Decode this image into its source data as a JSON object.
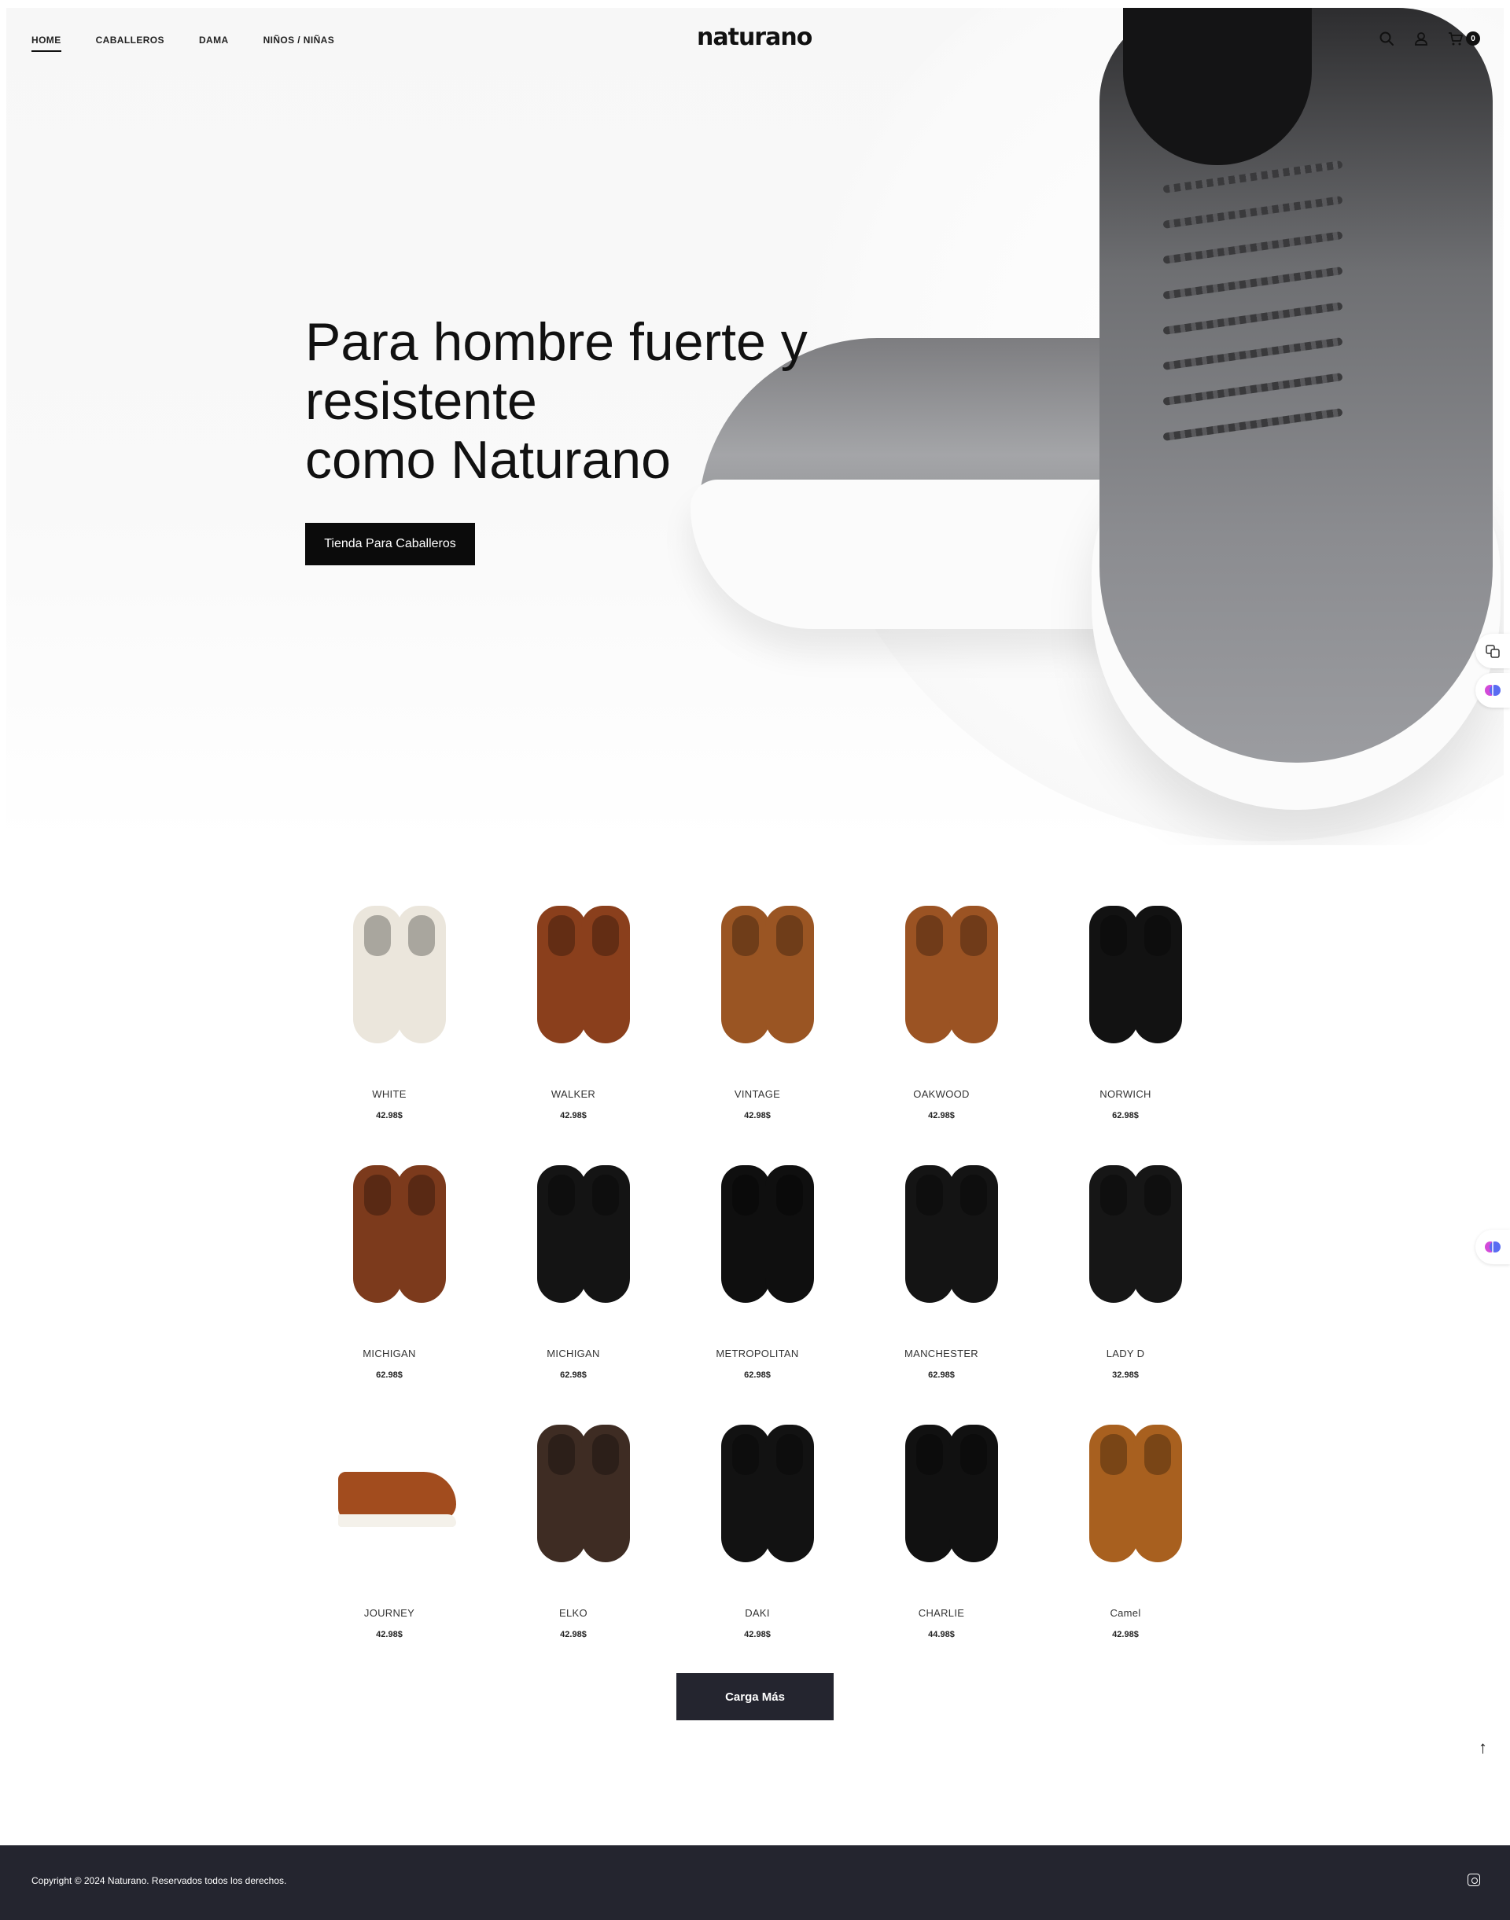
{
  "header": {
    "logo": "naturano",
    "nav": [
      {
        "label": "HOME",
        "active": true
      },
      {
        "label": "CABALLEROS",
        "active": false
      },
      {
        "label": "DAMA",
        "active": false
      },
      {
        "label": "NIÑOS / NIÑAS",
        "active": false
      }
    ],
    "icons": [
      "search-icon",
      "user-icon",
      "cart-icon"
    ],
    "cart_count": "0"
  },
  "hero": {
    "title_lines": [
      "Para hombre fuerte y",
      "resistente",
      "como Naturano"
    ],
    "button_label": "Tienda Para Caballeros"
  },
  "products": [
    {
      "name": "WHITE",
      "price": "42.98$",
      "color": "#ebe6dc"
    },
    {
      "name": "WALKER",
      "price": "42.98$",
      "color": "#8a3f1c"
    },
    {
      "name": "VINTAGE",
      "price": "42.98$",
      "color": "#9a5523"
    },
    {
      "name": "OAKWOOD",
      "price": "42.98$",
      "color": "#9b5323"
    },
    {
      "name": "NORWICH",
      "price": "62.98$",
      "color": "#121212"
    },
    {
      "name": "MICHIGAN",
      "price": "62.98$",
      "color": "#7c3a1c"
    },
    {
      "name": "MICHIGAN",
      "price": "62.98$",
      "color": "#141414"
    },
    {
      "name": "METROPOLITAN",
      "price": "62.98$",
      "color": "#0f0f0f"
    },
    {
      "name": "MANCHESTER",
      "price": "62.98$",
      "color": "#141414"
    },
    {
      "name": "LADY D",
      "price": "32.98$",
      "color": "#161616"
    },
    {
      "name": "JOURNEY",
      "price": "42.98$",
      "color": "#a24c1e",
      "view": "side"
    },
    {
      "name": "ELKO",
      "price": "42.98$",
      "color": "#3e2c23"
    },
    {
      "name": "DAKI",
      "price": "42.98$",
      "color": "#121212"
    },
    {
      "name": "CHARLIE",
      "price": "44.98$",
      "color": "#111111"
    },
    {
      "name": "Camel",
      "price": "42.98$",
      "color": "#a8601f"
    }
  ],
  "load_more_label": "Carga Más",
  "scroll_top": "↑",
  "footer": {
    "copyright": "Copyright © 2024 Naturano. Reservados todos los derechos."
  }
}
